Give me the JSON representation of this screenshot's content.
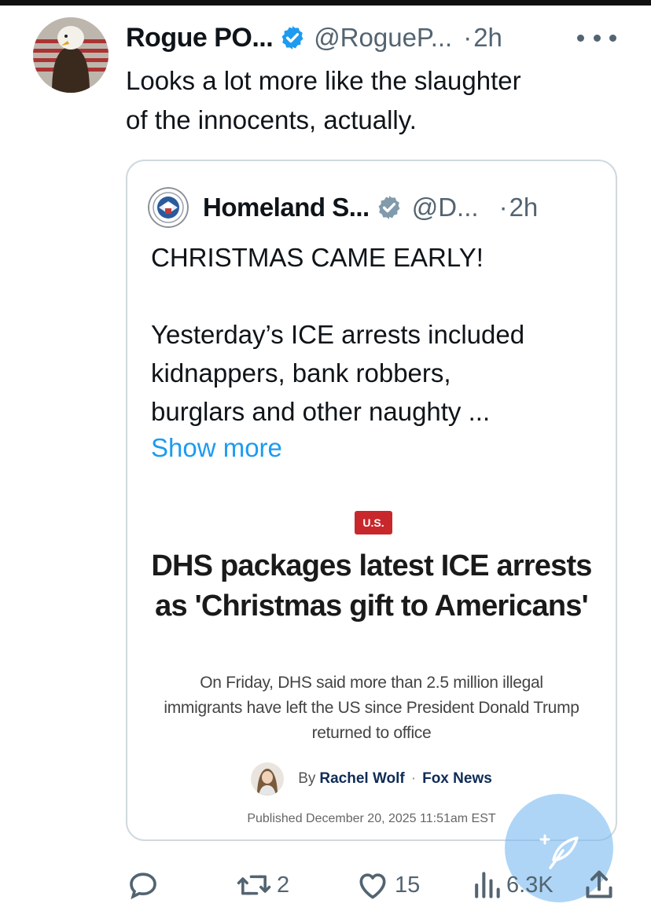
{
  "tweet": {
    "author_name": "Rogue PO...",
    "handle": "@RogueP...",
    "separator": "·",
    "time": "2h",
    "text_lines": [
      "Looks a lot more like the slaughter",
      "of the innocents, actually."
    ],
    "verified_icon": "verified-badge-icon",
    "verified_color": "#1d9bf0"
  },
  "quote": {
    "author_name": "Homeland S...",
    "handle": "@D...",
    "separator": "·",
    "time": "2h",
    "lines": [
      "CHRISTMAS CAME EARLY!",
      "Yesterday’s ICE arrests included",
      "kidnappers, bank robbers,",
      "burglars and other naughty ..."
    ],
    "show_more": "Show more",
    "show_more_color": "#1d9bf0",
    "verified_icon": "verified-badge-gray-icon"
  },
  "article": {
    "section_badge": "U.S.",
    "badge_color": "#c8272c",
    "headline": "DHS packages latest ICE arrests as 'Christmas gift to Americans'",
    "subheadline": "On Friday, DHS said more than 2.5 million illegal immigrants have left the US since President Donald Trump returned to office",
    "byline_prefix": "By",
    "byline_author": "Rachel Wolf",
    "byline_separator": "·",
    "byline_outlet": "Fox News",
    "published": "Published December 20, 2025 11:51am EST"
  },
  "actions": {
    "reply_count": "",
    "retweet_count": "2",
    "like_count": "15",
    "views_count": "6.3K"
  }
}
